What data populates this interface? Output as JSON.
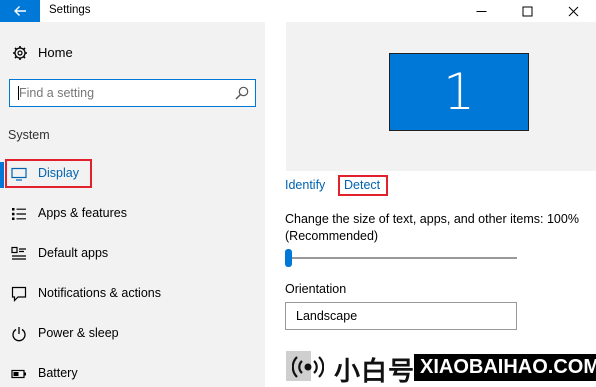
{
  "window": {
    "title": "Settings"
  },
  "sidebar": {
    "home_label": "Home",
    "search_placeholder": "Find a setting",
    "section_label": "System",
    "items": [
      {
        "label": "Display",
        "icon": "monitor-icon",
        "active": true
      },
      {
        "label": "Apps & features",
        "icon": "apps-list-icon",
        "active": false
      },
      {
        "label": "Default apps",
        "icon": "default-apps-icon",
        "active": false
      },
      {
        "label": "Notifications & actions",
        "icon": "notification-icon",
        "active": false
      },
      {
        "label": "Power & sleep",
        "icon": "power-icon",
        "active": false
      },
      {
        "label": "Battery",
        "icon": "battery-icon",
        "active": false
      }
    ]
  },
  "main": {
    "monitor_number": "1",
    "identify_label": "Identify",
    "detect_label": "Detect",
    "scale_label": "Change the size of text, apps, and other items: 100% (Recommended)",
    "scale_value_fraction": 0.0,
    "orientation_label": "Orientation",
    "orientation_value": "Landscape"
  },
  "watermark": {
    "brand_cn": "小白号",
    "brand_en": "XIAOBAIHAO.COM"
  },
  "colors": {
    "accent": "#0078d7",
    "link": "#0063b1",
    "highlight_box": "#e3212d",
    "sidebar_bg": "#f2f2f2"
  }
}
